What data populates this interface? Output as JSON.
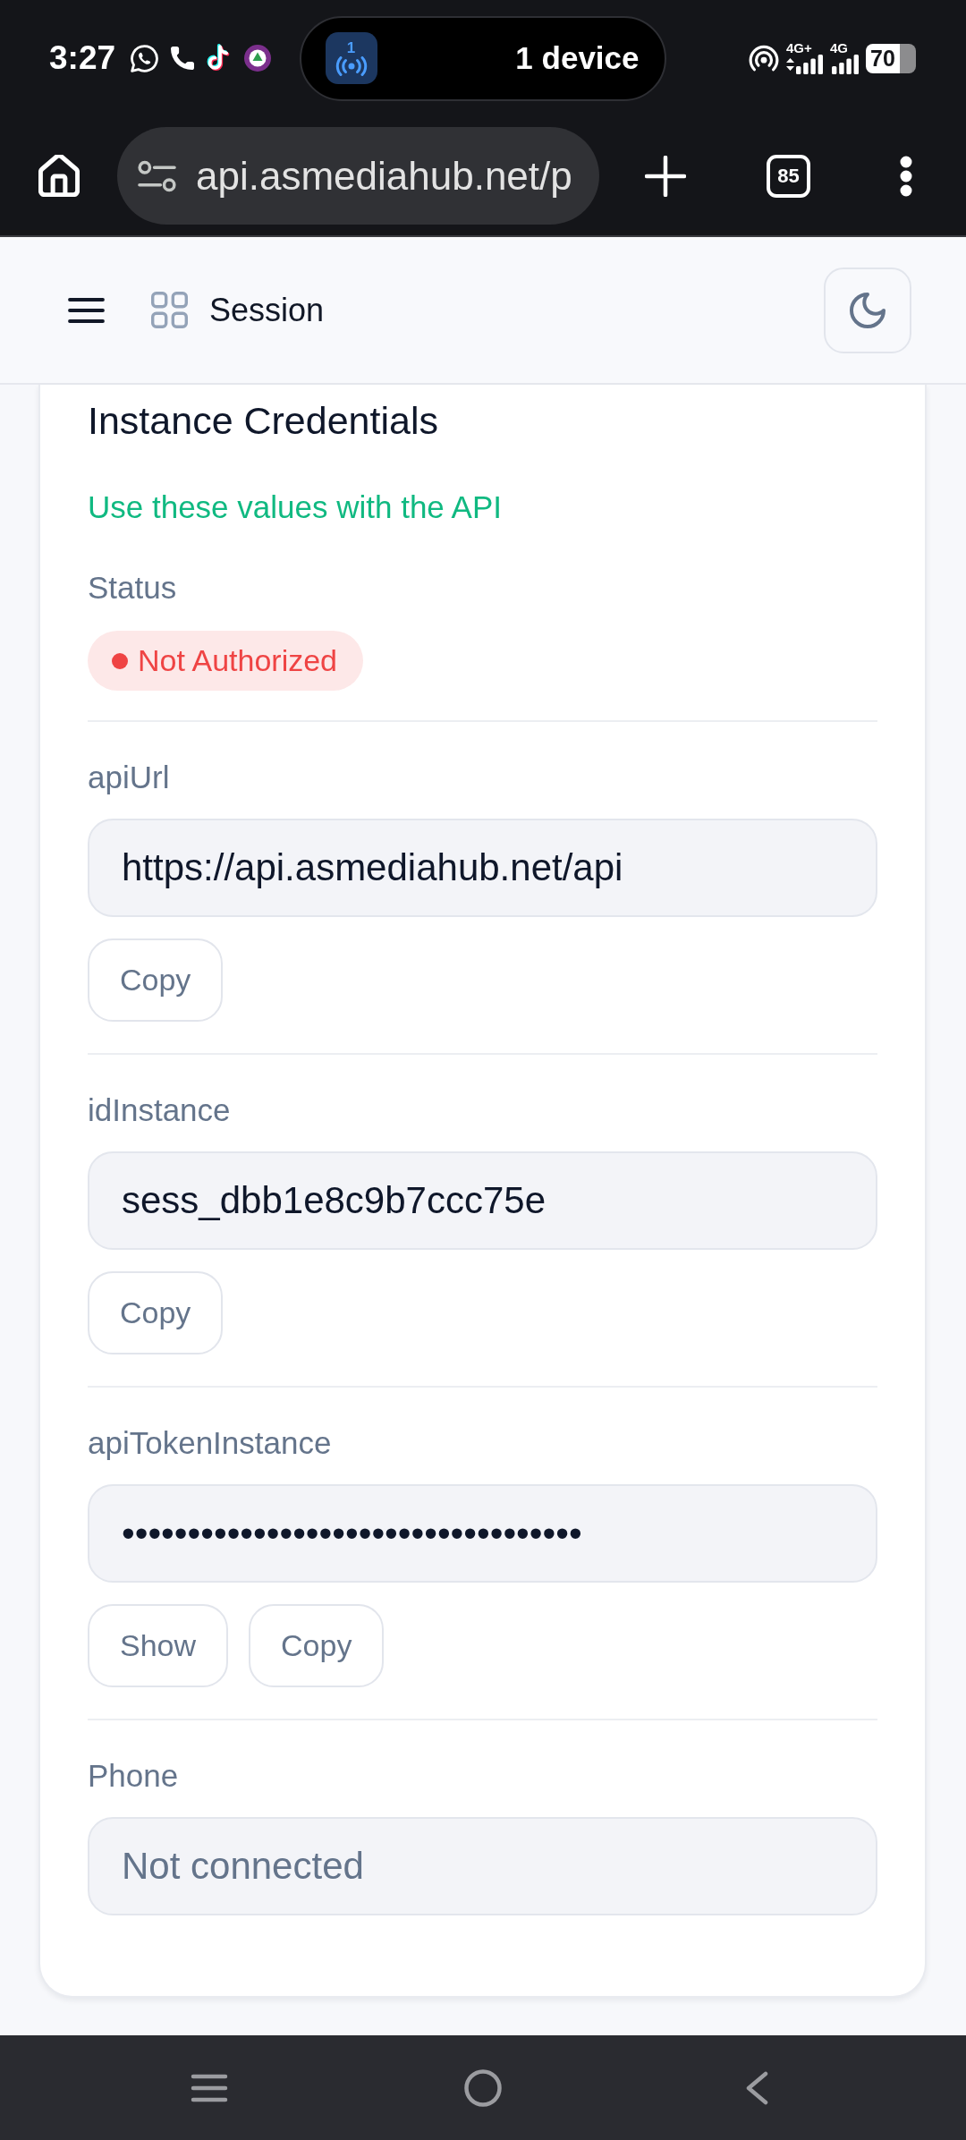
{
  "status_bar": {
    "time": "3:27",
    "live_activity": {
      "badge": "1",
      "text": "1 device"
    },
    "networks": [
      {
        "label": "4G+",
        "transferring": true
      },
      {
        "label": "4G",
        "transferring": false
      }
    ],
    "battery": "70"
  },
  "browser": {
    "url": "api.asmediahub.net/p",
    "tab_count": "85"
  },
  "header": {
    "title": "Session"
  },
  "card": {
    "title": "Instance Credentials",
    "subtitle": "Use these values with the API",
    "status": {
      "label": "Status",
      "value": "Not Authorized",
      "authorized": false
    },
    "fields": [
      {
        "label": "apiUrl",
        "value": "https://api.asmediahub.net/api",
        "actions": [
          "Copy"
        ]
      },
      {
        "label": "idInstance",
        "value": "sess_dbb1e8c9b7ccc75e",
        "actions": [
          "Copy"
        ]
      },
      {
        "label": "apiTokenInstance",
        "value": "•••••••••••••••••••••••••••••••••••",
        "actions": [
          "Show",
          "Copy"
        ]
      },
      {
        "label": "Phone",
        "placeholder": "Not connected"
      }
    ]
  }
}
